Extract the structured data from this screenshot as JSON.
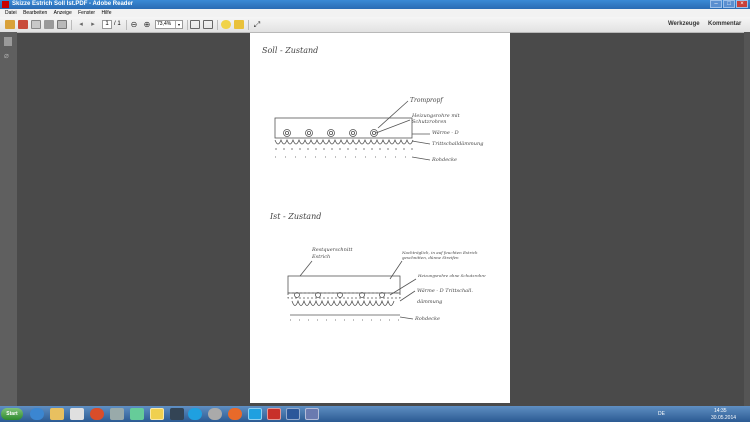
{
  "window": {
    "title": "Skizze Estrich Soll Ist.PDF - Adobe Reader"
  },
  "menu": {
    "items": [
      "Datei",
      "Bearbeiten",
      "Anzeige",
      "Fenster",
      "Hilfe"
    ]
  },
  "toolbar": {
    "page_current": "1",
    "page_total": "/ 1",
    "zoom": "73,4%",
    "werkzeuge": "Werkzeuge",
    "kommentar": "Kommentar"
  },
  "document": {
    "soll_heading": "Soll - Zustand",
    "soll_labels": [
      "Trompropf",
      "Heizungsrohre mit Schutzrohren",
      "Wärme - D",
      "Trittschalldämmung",
      "Rohdecke"
    ],
    "ist_heading": "Ist - Zustand",
    "ist_labels": [
      "Restquerschnitt Estrich",
      "Nachträglich, in auf feuchten Estrich geschnitten, dünne Streifen",
      "Heizungsrohre ohne Schutzrohre",
      "Wärme - D Trittschall.",
      "dämmung",
      "Rohdecke"
    ]
  },
  "taskbar": {
    "start": "Start",
    "lang": "DE",
    "time": "14:35",
    "date": "30.05.2014"
  },
  "colors": {
    "titlebar": "#2a6bb3",
    "workspace": "#4a4a4a",
    "taskbar": "#2b5a92"
  }
}
